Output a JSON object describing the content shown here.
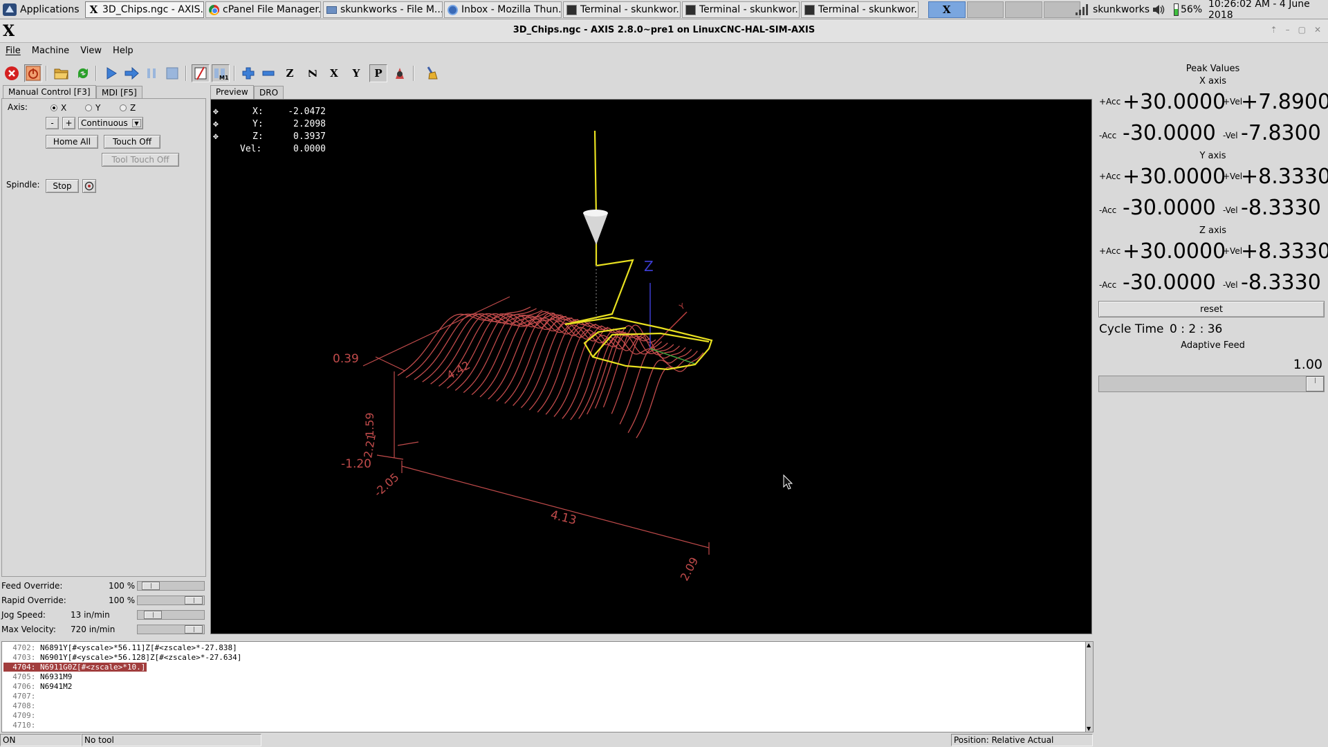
{
  "taskbar": {
    "apps_label": "Applications",
    "tasks": [
      {
        "label": "3D_Chips.ngc - AXIS...",
        "icon": "x-icon"
      },
      {
        "label": "cPanel File Manager...",
        "icon": "chrome-icon"
      },
      {
        "label": "skunkworks - File M...",
        "icon": "folder-icon"
      },
      {
        "label": "Inbox - Mozilla Thun...",
        "icon": "thunderbird-icon"
      },
      {
        "label": "Terminal - skunkwor...",
        "icon": "terminal-icon"
      },
      {
        "label": "Terminal - skunkwor...",
        "icon": "terminal-icon"
      },
      {
        "label": "Terminal - skunkwor...",
        "icon": "terminal-icon"
      }
    ],
    "workspace_current": "X",
    "network_label": "skunkworks",
    "battery": "56%",
    "datetime": "10:26:02 AM - 4 June 2018"
  },
  "window": {
    "title": "3D_Chips.ngc - AXIS 2.8.0~pre1 on LinuxCNC-HAL-SIM-AXIS",
    "logo": "X"
  },
  "menu": {
    "file": "File",
    "machine": "Machine",
    "view": "View",
    "help": "Help"
  },
  "left": {
    "tab_manual": "Manual Control [F3]",
    "tab_mdi": "MDI [F5]",
    "axis_label": "Axis:",
    "axes": [
      "X",
      "Y",
      "Z"
    ],
    "minus": "-",
    "plus": "+",
    "jog_mode": "Continuous",
    "home_all": "Home All",
    "touch_off": "Touch Off",
    "tool_touch_off": "Tool Touch Off",
    "spindle_label": "Spindle:",
    "spindle_stop": "Stop",
    "feed_override_label": "Feed Override:",
    "feed_override_value": "100 %",
    "rapid_override_label": "Rapid Override:",
    "rapid_override_value": "100 %",
    "jog_speed_label": "Jog Speed:",
    "jog_speed_value": "13 in/min",
    "max_velocity_label": "Max Velocity:",
    "max_velocity_value": "720 in/min"
  },
  "preview": {
    "tab_preview": "Preview",
    "tab_dro": "DRO",
    "dro": {
      "x_label": "X:",
      "x": "-2.0472",
      "y_label": "Y:",
      "y": "2.2098",
      "z_label": "Z:",
      "z": "0.3937",
      "vel_label": "Vel:",
      "vel": "0.0000"
    },
    "dims": {
      "z_top": "0.39",
      "z_mid": "1.59",
      "z_bot": "-1.20",
      "y_len": "4.42",
      "y_bot": "2.21",
      "x_left": "-2.05",
      "x_len": "4.13",
      "x_right": "2.09",
      "y_near": "2.2"
    },
    "axis_z": "Z",
    "axis_y": "Y"
  },
  "peak": {
    "title": "Peak Values",
    "acc_plus": "+Acc",
    "acc_minus": "-Acc",
    "vel_plus": "+Vel",
    "vel_minus": "-Vel",
    "x_axis": "X axis",
    "x_acc_p": "+30.0000",
    "x_vel_p": "+7.8900",
    "x_acc_m": "-30.0000",
    "x_vel_m": "-7.8300",
    "y_axis": "Y axis",
    "y_acc_p": "+30.0000",
    "y_vel_p": "+8.3330",
    "y_acc_m": "-30.0000",
    "y_vel_m": "-8.3330",
    "z_axis": "Z axis",
    "z_acc_p": "+30.0000",
    "z_vel_p": "+8.3330",
    "z_acc_m": "-30.0000",
    "z_vel_m": "-8.3330",
    "reset": "reset",
    "cycle_label": "Cycle Time",
    "cycle_value": "0 : 2 : 36",
    "adaptive_label": "Adaptive Feed",
    "adaptive_value": "1.00",
    "adaptive_level": 1.0
  },
  "gcode": [
    {
      "num": "4702:",
      "code": "N6891Y[#<yscale>*56.11]Z[#<zscale>*-27.838]"
    },
    {
      "num": "4703:",
      "code": "N6901Y[#<yscale>*56.128]Z[#<zscale>*-27.634]"
    },
    {
      "num": "4704:",
      "code": "N6911G0Z[#<zscale>*10.]"
    },
    {
      "num": "4705:",
      "code": "N6931M9"
    },
    {
      "num": "4706:",
      "code": "N6941M2"
    },
    {
      "num": "4707:",
      "code": ""
    },
    {
      "num": "4708:",
      "code": ""
    },
    {
      "num": "4709:",
      "code": ""
    },
    {
      "num": "4710:",
      "code": ""
    }
  ],
  "status": {
    "state": "ON",
    "tool": "No tool",
    "position": "Position: Relative Actual"
  }
}
